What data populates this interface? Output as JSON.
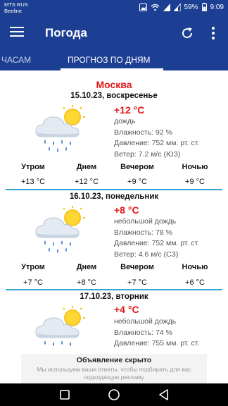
{
  "status_bar": {
    "carrier_line1": "MTS RUS",
    "carrier_line2": "Beeline",
    "battery": "59%",
    "time": "9:09"
  },
  "app_bar": {
    "title": "Погода",
    "menu_icon": "hamburger-menu-icon",
    "refresh_icon": "refresh-icon",
    "more_icon": "more-vert-icon"
  },
  "tabs": [
    {
      "label": "ЧАСАМ",
      "selected": false
    },
    {
      "label": "ПРОГНОЗ ПО ДНЯМ",
      "selected": true
    }
  ],
  "colors": {
    "primary": "#1c3f94",
    "accent_red": "#e01717",
    "divider": "#3aa3d6"
  },
  "forecast": {
    "city": "Москва",
    "days": [
      {
        "date": "15.10.23, воскресенье",
        "temp": "+12 °C",
        "condition": "дождь",
        "humidity": "Влажность: 92 %",
        "pressure": "Давление: 752 мм. рт. ст.",
        "wind": "Ветер: 7.2 м/с (ЮЗ)",
        "icon": "sun-cloud-rain-icon",
        "periods": [
          {
            "label": "Утром",
            "temp": "+13 °C"
          },
          {
            "label": "Днем",
            "temp": "+12 °C"
          },
          {
            "label": "Вечером",
            "temp": "+9 °C"
          },
          {
            "label": "Ночью",
            "temp": "+9 °C"
          }
        ]
      },
      {
        "date": "16.10.23, понедельник",
        "temp": "+8 °C",
        "condition": "небольшой дождь",
        "humidity": "Влажность: 78 %",
        "pressure": "Давление: 752 мм. рт. ст.",
        "wind": "Ветер: 4.6 м/с (СЗ)",
        "icon": "sun-cloud-rain-icon",
        "periods": [
          {
            "label": "Утром",
            "temp": "+7 °C"
          },
          {
            "label": "Днем",
            "temp": "+8 °C"
          },
          {
            "label": "Вечером",
            "temp": "+7 °C"
          },
          {
            "label": "Ночью",
            "temp": "+6 °C"
          }
        ]
      },
      {
        "date": "17.10.23, вторник",
        "temp": "+4 °C",
        "condition": "небольшой дождь",
        "humidity": "Влажность: 74 %",
        "pressure": "Давление: 755 мм. рт. ст.",
        "icon": "sun-cloud-rain-icon"
      }
    ]
  },
  "ad": {
    "title": "Объявление скрыто",
    "text": "Мы используем ваши ответы, чтобы подбирать для вас подходящую рекламу"
  },
  "nav_bar": {
    "recents_icon": "recents-square-icon",
    "home_icon": "home-circle-icon",
    "back_icon": "back-triangle-icon"
  }
}
